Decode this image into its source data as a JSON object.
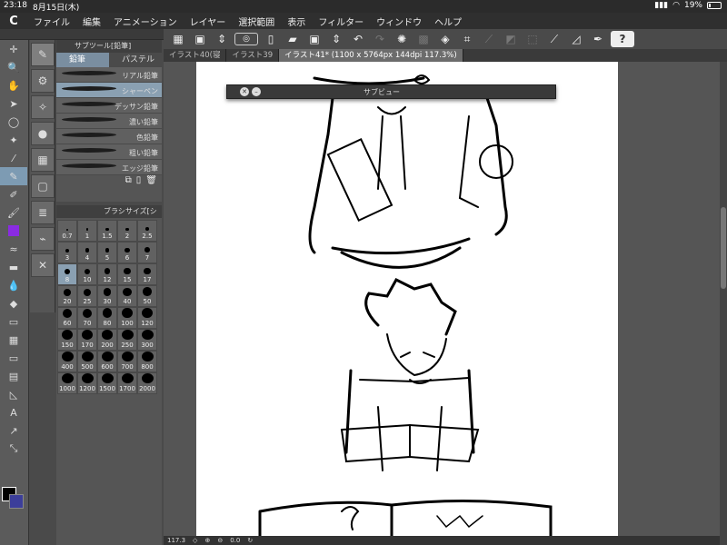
{
  "status": {
    "time": "23:18",
    "date": "8月15日(木)",
    "battery": "19%",
    "battery_level": 0.19
  },
  "menu": {
    "logo": "C",
    "items": [
      "ファイル",
      "編集",
      "アニメーション",
      "レイヤー",
      "選択範囲",
      "表示",
      "フィルター",
      "ウィンドウ",
      "ヘルプ"
    ]
  },
  "subtool_panel": {
    "title": "サブツール[鉛筆]",
    "tabs": [
      "鉛筆",
      "パステル"
    ],
    "pencils": [
      "リアル鉛筆",
      "シャーペン",
      "デッサン鉛筆",
      "濃い鉛筆",
      "色鉛筆",
      "粗い鉛筆",
      "エッジ鉛筆"
    ],
    "selected_pencil": 1
  },
  "brush_size": {
    "title": "ブラシサイズ[シ",
    "sizes": [
      "0.7",
      "1",
      "1.5",
      "2",
      "2.5",
      "3",
      "4",
      "5",
      "6",
      "7",
      "8",
      "10",
      "12",
      "15",
      "17",
      "20",
      "25",
      "30",
      "40",
      "50",
      "60",
      "70",
      "80",
      "100",
      "120",
      "150",
      "170",
      "200",
      "250",
      "300",
      "400",
      "500",
      "600",
      "700",
      "800",
      "1000",
      "1200",
      "1500",
      "1700",
      "2000"
    ],
    "selected": "8"
  },
  "doc_tabs": [
    "イラスト40(寝",
    "イラスト39",
    "イラスト41* (1100 x 5764px 144dpi 117.3%)"
  ],
  "subview": {
    "title": "サブビュー"
  },
  "bottom": {
    "zoom": "117.3",
    "angle": "0.0"
  },
  "colors": {
    "main": "#000000",
    "sub": "#3c3e9a",
    "selection": "#8aa0b2"
  }
}
